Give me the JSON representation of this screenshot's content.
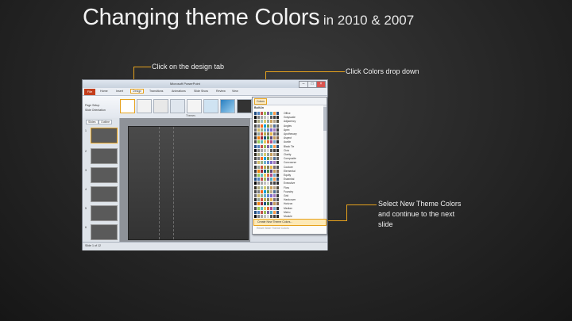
{
  "heading": {
    "main": "Changing theme Colors",
    "sub": "in 2010 & 2007"
  },
  "callouts": {
    "design_tab": "Click on the design tab",
    "colors_dropdown": "Click Colors drop down",
    "new_theme": "Select New Theme Colors and continue to the next slide"
  },
  "accent_color": "#e6a21e",
  "screenshot": {
    "window_title": "Microsoft PowerPoint",
    "file_tab": "File",
    "tabs": [
      "Home",
      "Insert",
      "Design",
      "Transitions",
      "Animations",
      "Slide Show",
      "Review",
      "View"
    ],
    "ribbon": {
      "page_setup": "Page Setup",
      "slide_orientation": "Slide Orientation",
      "themes_group": "Themes",
      "colors_btn": "Colors"
    },
    "left_tabs": [
      "Slides",
      "Outline"
    ],
    "slide_numbers": [
      "1",
      "2",
      "3",
      "4",
      "5",
      "6"
    ],
    "dropdown": {
      "button": "Colors",
      "header": "",
      "section": "Built-In",
      "themes": [
        "Office",
        "Grayscale",
        "Adjacency",
        "Angles",
        "Apex",
        "Apothecary",
        "Aspect",
        "Austin",
        "Black Tie",
        "Civic",
        "Clarity",
        "Composite",
        "Concourse",
        "Couture",
        "Elemental",
        "Equity",
        "Essential",
        "Executive",
        "Flow",
        "Foundry",
        "Grid",
        "Hardcover",
        "Horizon",
        "Median",
        "Metro",
        "Module"
      ],
      "new_colors": "Create New Theme Colors...",
      "reset": "Reset Slide Theme Colors"
    },
    "status": {
      "slide": "Slide 1 of 12",
      "theme": ""
    }
  }
}
